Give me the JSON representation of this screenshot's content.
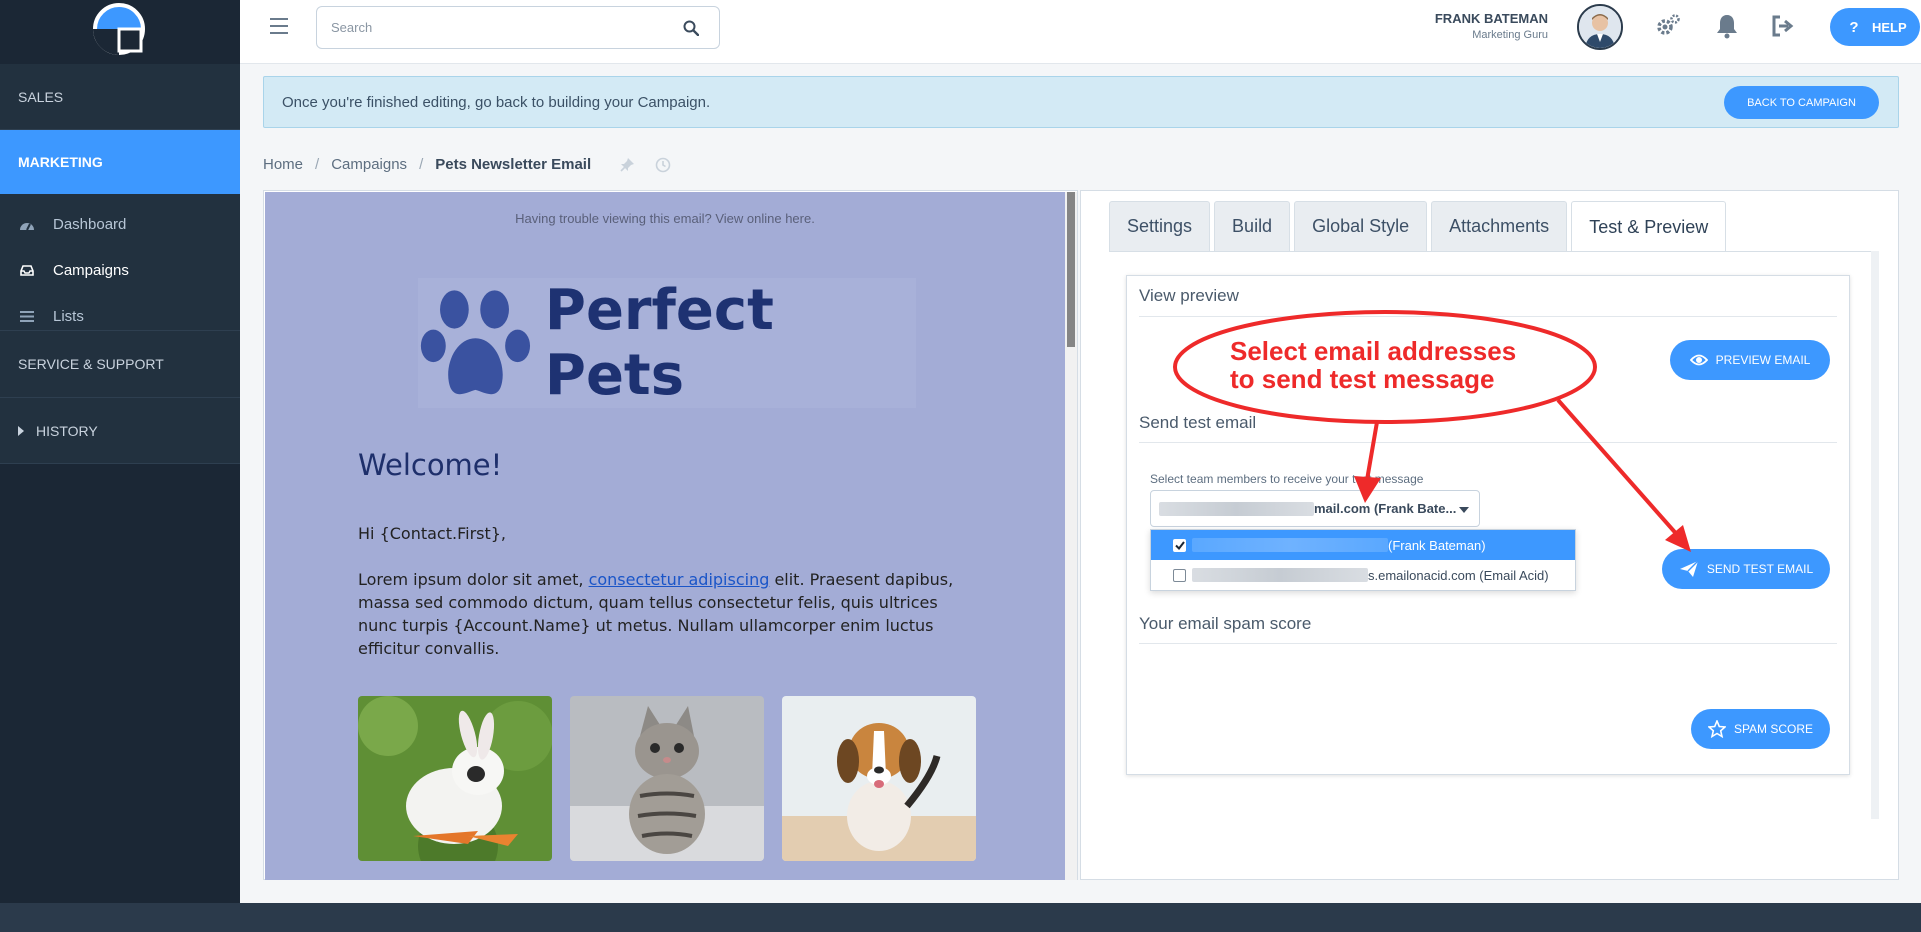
{
  "sidebar": {
    "sections": {
      "sales": "SALES",
      "marketing": "MARKETING",
      "service": "SERVICE & SUPPORT",
      "history": "HISTORY"
    },
    "items": [
      {
        "label": "Dashboard",
        "icon": "dashboard-icon"
      },
      {
        "label": "Campaigns",
        "icon": "inbox-icon"
      },
      {
        "label": "Lists",
        "icon": "list-icon"
      }
    ]
  },
  "topbar": {
    "search_placeholder": "Search",
    "user_name": "FRANK BATEMAN",
    "user_role": "Marketing Guru",
    "help_label": "HELP"
  },
  "banner": {
    "text": "Once you're finished editing, go back to building your Campaign.",
    "button": "BACK TO CAMPAIGN"
  },
  "breadcrumb": {
    "home": "Home",
    "campaigns": "Campaigns",
    "current": "Pets Newsletter Email"
  },
  "email": {
    "trouble": "Having trouble viewing this email? View online here.",
    "brand": "Perfect Pets",
    "welcome": "Welcome!",
    "greeting": "Hi {Contact.First},",
    "lorem_before": "Lorem ipsum dolor sit amet, ",
    "lorem_link": "consectetur adipiscing",
    "lorem_after": " elit. Praesent dapibus, massa sed commodo dictum, quam tellus consectetur felis, quis ultrices nunc turpis {Account.Name} ut metus. Nullam ullamcorper enim luctus efficitur convallis."
  },
  "tabs": [
    {
      "label": "Settings"
    },
    {
      "label": "Build"
    },
    {
      "label": "Global Style"
    },
    {
      "label": "Attachments"
    },
    {
      "label": "Test & Preview"
    }
  ],
  "preview": {
    "view_title": "View preview",
    "preview_button": "PREVIEW EMAIL",
    "send_title": "Send test email",
    "select_label": "Select team members to receive your test message",
    "select_value_suffix": "mail.com (Frank Bate...",
    "options": [
      {
        "label": "(Frank Bateman)",
        "checked": true
      },
      {
        "label": "s.emailonacid.com (Email Acid)",
        "checked": false
      }
    ],
    "send_button": "SEND TEST EMAIL",
    "spam_title": "Your email spam score",
    "spam_button": "SPAM SCORE"
  },
  "annotation": {
    "line1": "Select email addresses",
    "line2": "to send test message"
  },
  "colors": {
    "accent": "#3d98ff",
    "sidebar": "#1b2735",
    "annotation": "#ee2a2a",
    "email_bg": "#a3acd6",
    "brand": "#1e3272"
  }
}
